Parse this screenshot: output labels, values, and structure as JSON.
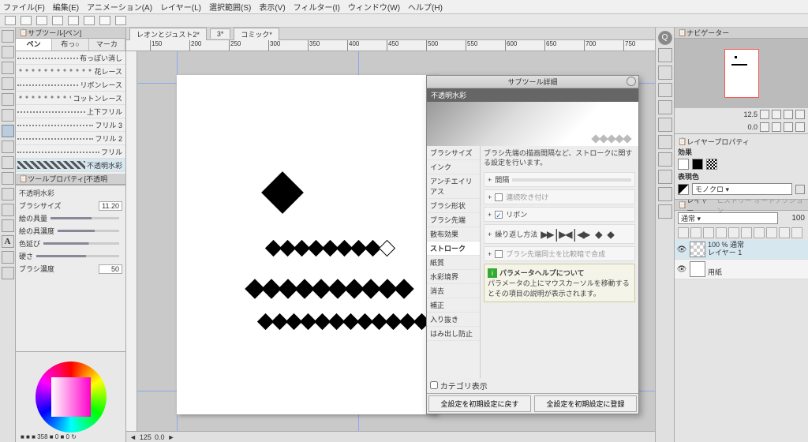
{
  "menu": [
    "ファイル(F)",
    "編集(E)",
    "アニメーション(A)",
    "レイヤー(L)",
    "選択範囲(S)",
    "表示(V)",
    "フィルター(I)",
    "ウィンドウ(W)",
    "ヘルプ(H)"
  ],
  "subtool_hdr": "サブツール[ペン]",
  "tabs": [
    "ペン",
    "布っ○",
    "マーカ"
  ],
  "brushes": [
    {
      "name": "布っぽい消し"
    },
    {
      "name": "花レース"
    },
    {
      "name": "リボンレース"
    },
    {
      "name": "コットンレース"
    },
    {
      "name": "上下フリル"
    },
    {
      "name": "フリル 3"
    },
    {
      "name": "フリル 2"
    },
    {
      "name": "フリル"
    },
    {
      "name": "不透明水彩",
      "sel": true
    }
  ],
  "toolprop_hdr": "ツールプロパティ[不透明",
  "toolprop_name": "不透明水彩",
  "props": {
    "brush_size_lbl": "ブラシサイズ",
    "brush_size_val": "11.20",
    "paint_amt_lbl": "絵の具量",
    "paint_den_lbl": "絵の具濃度",
    "color_ext_lbl": "色延び",
    "hardness_lbl": "硬さ",
    "brush_den_lbl": "ブラシ濃度",
    "brush_den_val": "50"
  },
  "hue_val": "358",
  "doc_tabs": [
    "レオンとジュスト2*",
    "3*",
    "コミック*"
  ],
  "ruler_ticks": [
    "150",
    "200",
    "250",
    "300",
    "350",
    "400",
    "450",
    "500",
    "550",
    "600",
    "650",
    "700",
    "750"
  ],
  "scroll_vals": [
    "125",
    "0.0"
  ],
  "popup": {
    "title": "サブツール詳細",
    "subtitle": "不透明水彩",
    "cats": [
      "ブラシサイズ",
      "インク",
      "アンチエイリアス",
      "ブラシ形状",
      "ブラシ先端",
      "散布効果",
      "ストローク",
      "紙質",
      "水彩境界",
      "消去",
      "補正",
      "入り抜き",
      "はみ出し防止"
    ],
    "cat_sel": 6,
    "desc": "ブラシ先端の描画間隔など、ストロークに関する設定を行います。",
    "gap_lbl": "間隔",
    "cont_lbl": "連続吹き付け",
    "ribbon_lbl": "リボン",
    "repeat_lbl": "繰り返し方法",
    "blend_lbl": "ブラシ先端同士を比較暗で合成",
    "help_title": "パラメータヘルプについて",
    "help_text": "パラメータの上にマウスカーソルを移動するとその項目の説明が表示されます。",
    "category_chk": "カテゴリ表示",
    "btn_reset": "全設定を初期設定に戻す",
    "btn_save": "全設定を初期設定に登録"
  },
  "nav_hdr": "ナビゲーター",
  "nav_zoom": "12.5",
  "nav_rot": "0.0",
  "layerprop_hdr": "レイヤープロパティ",
  "effect_lbl": "効果",
  "expr_lbl": "表現色",
  "expr_val": "モノクロ",
  "layer_hdr": "レイヤー",
  "blend_mode": "通常",
  "opacity": "100",
  "layers": [
    {
      "opacity": "100 %",
      "mode": "通常",
      "name": "レイヤー 1",
      "sel": true
    },
    {
      "name": "用紙",
      "white": true
    }
  ]
}
